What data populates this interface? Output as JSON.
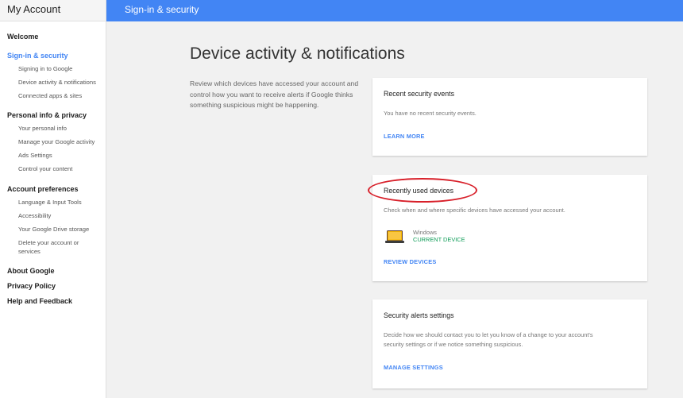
{
  "app": {
    "title": "My Account"
  },
  "topbar": {
    "title": "Sign-in & security"
  },
  "sidebar": {
    "welcome": "Welcome",
    "signin_section": "Sign-in & security",
    "signin_items": [
      "Signing in to Google",
      "Device activity & notifications",
      "Connected apps & sites"
    ],
    "personal_section": "Personal info & privacy",
    "personal_items": [
      "Your personal info",
      "Manage your Google activity",
      "Ads Settings",
      "Control your content"
    ],
    "account_section": "Account preferences",
    "account_items": [
      "Language & Input Tools",
      "Accessibility",
      "Your Google Drive storage",
      "Delete your account or services"
    ],
    "about": "About Google",
    "privacy": "Privacy Policy",
    "help": "Help and Feedback"
  },
  "main": {
    "title": "Device activity & notifications",
    "intro": "Review which devices have accessed your account and control how you want to receive alerts if Google thinks something suspicious might be happening."
  },
  "cards": {
    "recent_events": {
      "title": "Recent security events",
      "text": "You have no recent security events.",
      "link": "LEARN MORE"
    },
    "recent_devices": {
      "title": "Recently used devices",
      "text": "Check when and where specific devices have accessed your account.",
      "device_name": "Windows",
      "device_status": "CURRENT DEVICE",
      "link": "REVIEW DEVICES"
    },
    "alerts_settings": {
      "title": "Security alerts settings",
      "text": "Decide how we should contact you to let you know of a change to your account's security settings or if we notice something suspicious.",
      "link": "MANAGE SETTINGS"
    }
  },
  "colors": {
    "accent": "#4285f4",
    "current_device": "#0f9d58",
    "highlight": "#d8202a",
    "laptop": "#f4b400"
  },
  "icons": {
    "device": "laptop-icon"
  }
}
